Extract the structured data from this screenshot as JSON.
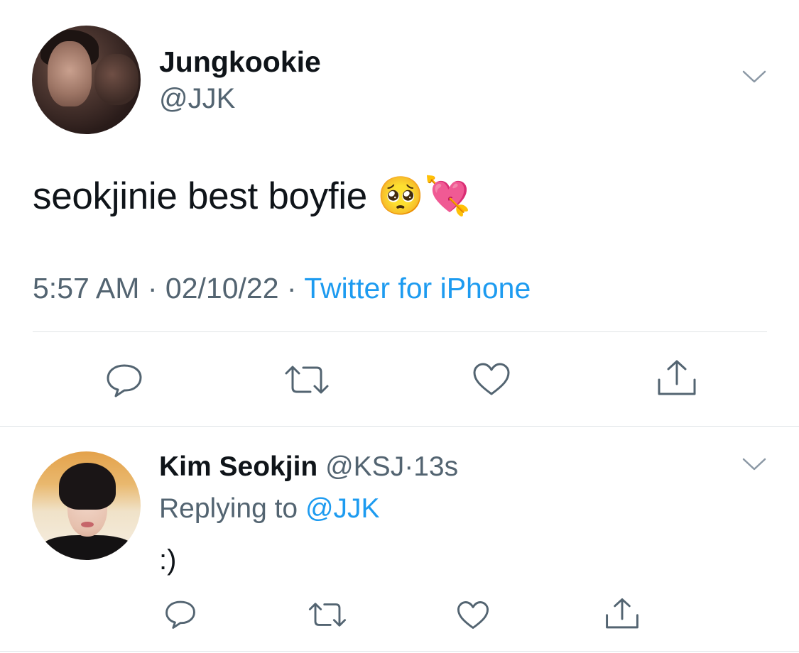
{
  "main_tweet": {
    "display_name": "Jungkookie",
    "handle": "@JJK",
    "text": "seokjinie best boyfie 🥺💘",
    "time": "5:57 AM",
    "date": "02/10/22",
    "source": "Twitter for iPhone",
    "separator": "·"
  },
  "reply": {
    "display_name": "Kim Seokjin",
    "handle": "@KSJ",
    "separator": "·",
    "age": "13s",
    "replying_prefix": "Replying to",
    "replying_handle": "@JJK",
    "text": ":)"
  },
  "icons": {
    "reply": "reply-icon",
    "retweet": "retweet-icon",
    "like": "heart-icon",
    "share": "share-icon",
    "menu": "chevron-down-icon"
  },
  "colors": {
    "text": "#0f1419",
    "secondary": "#536471",
    "link": "#1d9bf0",
    "divider": "#dfe3e6"
  }
}
